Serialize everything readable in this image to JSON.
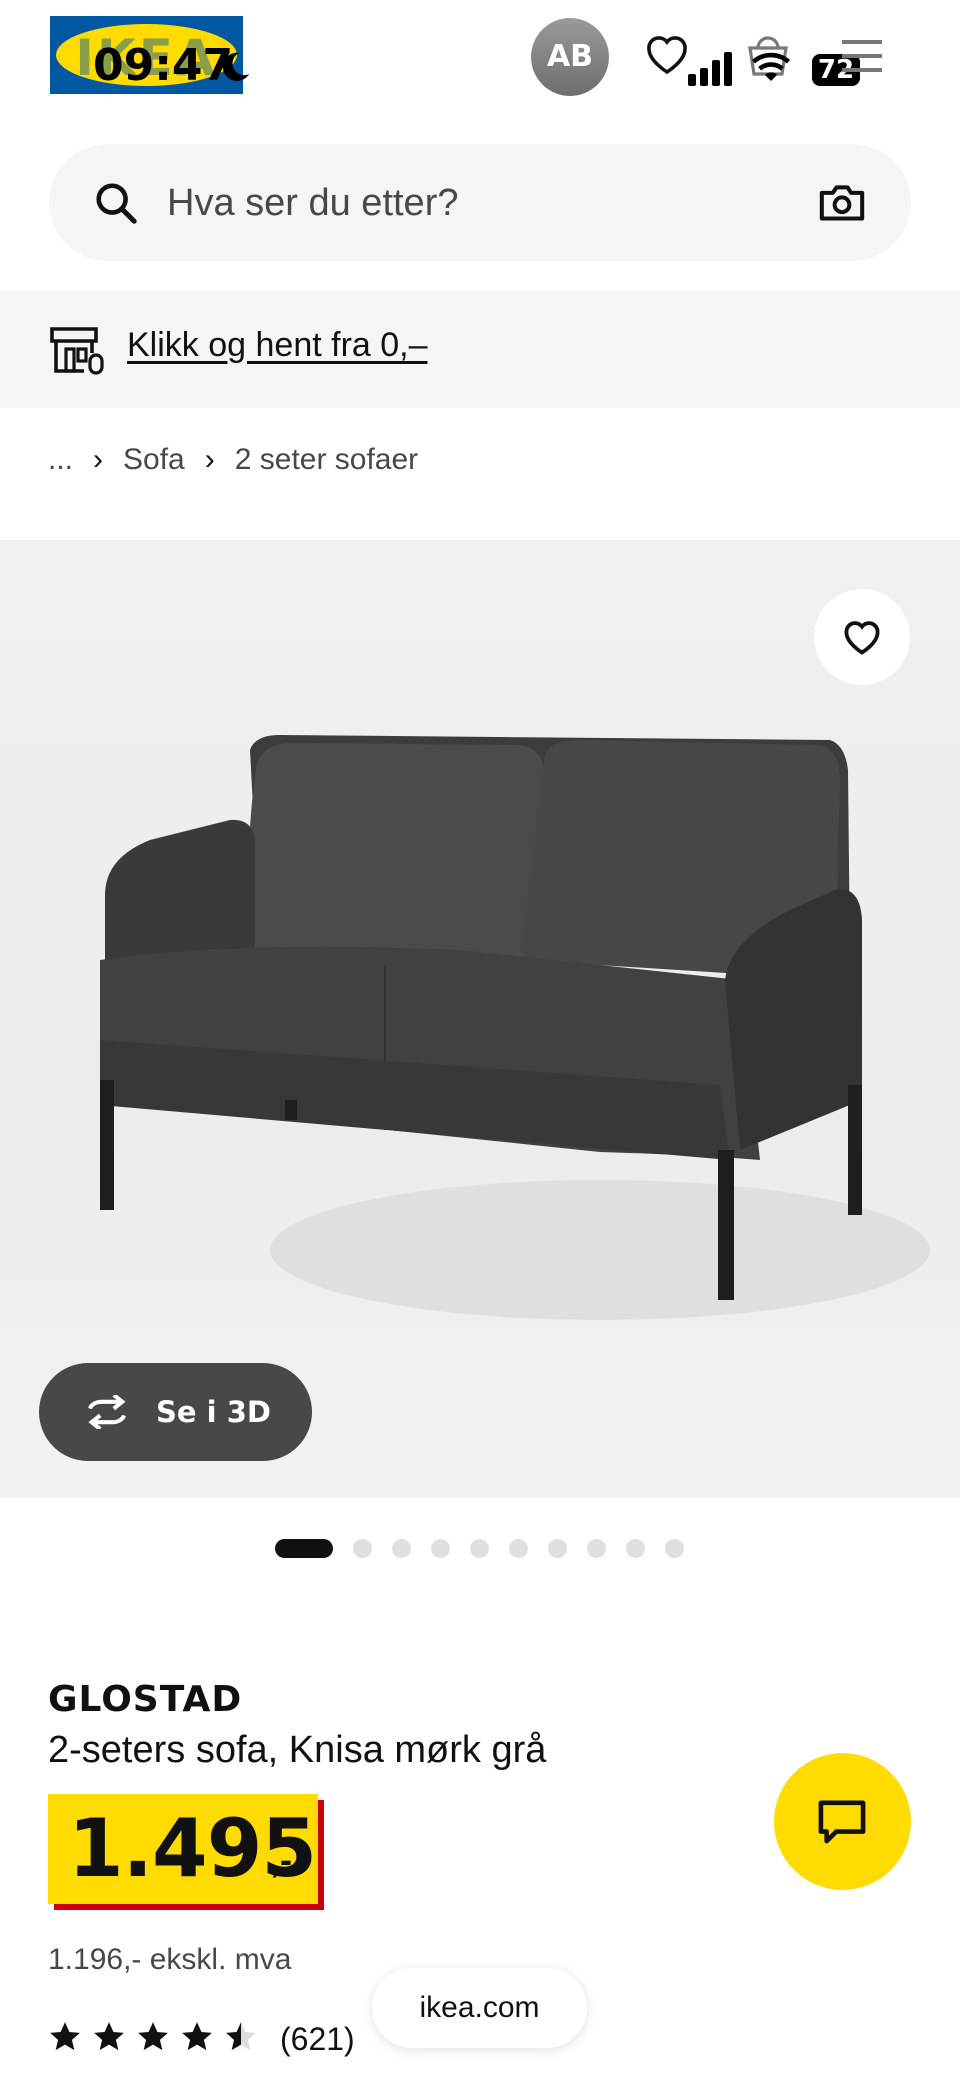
{
  "status_bar": {
    "time": "09:47",
    "battery": "72"
  },
  "header": {
    "logo_text": "IKEA",
    "avatar_initials": "AB"
  },
  "search": {
    "placeholder": "Hva ser du etter?"
  },
  "store_banner": {
    "link_text": "Klikk og hent fra 0,–"
  },
  "breadcrumb": {
    "ellipsis": "...",
    "items": [
      "Sofa",
      "2 seter sofaer"
    ],
    "separator": "›"
  },
  "gallery": {
    "view_3d_label": "Se i 3D",
    "image_count": 10,
    "active_index": 0
  },
  "product": {
    "name": "GLOSTAD",
    "description": "2-seters sofa, Knisa mørk grå",
    "price_main": "1.495",
    "price_suffix": ",-",
    "price_ex_vat": "1.196,- ekskl. mva",
    "rating": 4.5,
    "rating_max": 5,
    "review_count": "(621)"
  },
  "footer": {
    "domain_pill": "ikea.com"
  },
  "colors": {
    "brand_yellow": "#ffdb00",
    "brand_blue": "#0058a3",
    "price_shadow_red": "#cc0008",
    "dark_button": "#484848"
  },
  "icons": [
    "search-icon",
    "camera-icon",
    "heart-icon",
    "store-icon",
    "rotate-3d-icon",
    "chat-icon",
    "star-icon",
    "menu-icon",
    "shopping-bag-icon"
  ]
}
